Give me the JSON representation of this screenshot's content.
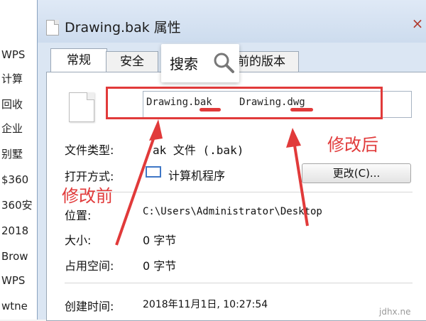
{
  "left_list": {
    "items": [
      "WPS",
      "计算",
      "回收",
      "企业",
      "别墅",
      "$360",
      "360安",
      "2018",
      "Brow",
      "WPS",
      "wtne"
    ]
  },
  "dialog": {
    "title": "Drawing.bak 属性",
    "tabs": [
      "常规",
      "安全",
      "以前的版本"
    ],
    "tab_partial_hidden": "前的版本",
    "file_name_before": "Drawing.bak",
    "file_name_after": "Drawing.dwg",
    "rows": [
      {
        "label": "文件类型:",
        "value": "ak 文件 (.bak)"
      },
      {
        "label": "打开方式:",
        "value": "计算机程序"
      },
      {
        "label": "位置:",
        "value": "C:\\Users\\Administrator\\Desktop"
      },
      {
        "label": "大小:",
        "value": "0 字节"
      },
      {
        "label": "占用空间:",
        "value": "0 字节"
      },
      {
        "label": "创建时间:",
        "value": "2018年11月1日, 10:27:54"
      }
    ],
    "change_button": "更改(C)..."
  },
  "search_overlay": {
    "label": "搜索",
    "icon": "search-icon"
  },
  "annotations": {
    "before_label": "修改前",
    "after_label": "修改后",
    "accent_color": "#e13a3a"
  },
  "watermark": "jdhx.ne"
}
